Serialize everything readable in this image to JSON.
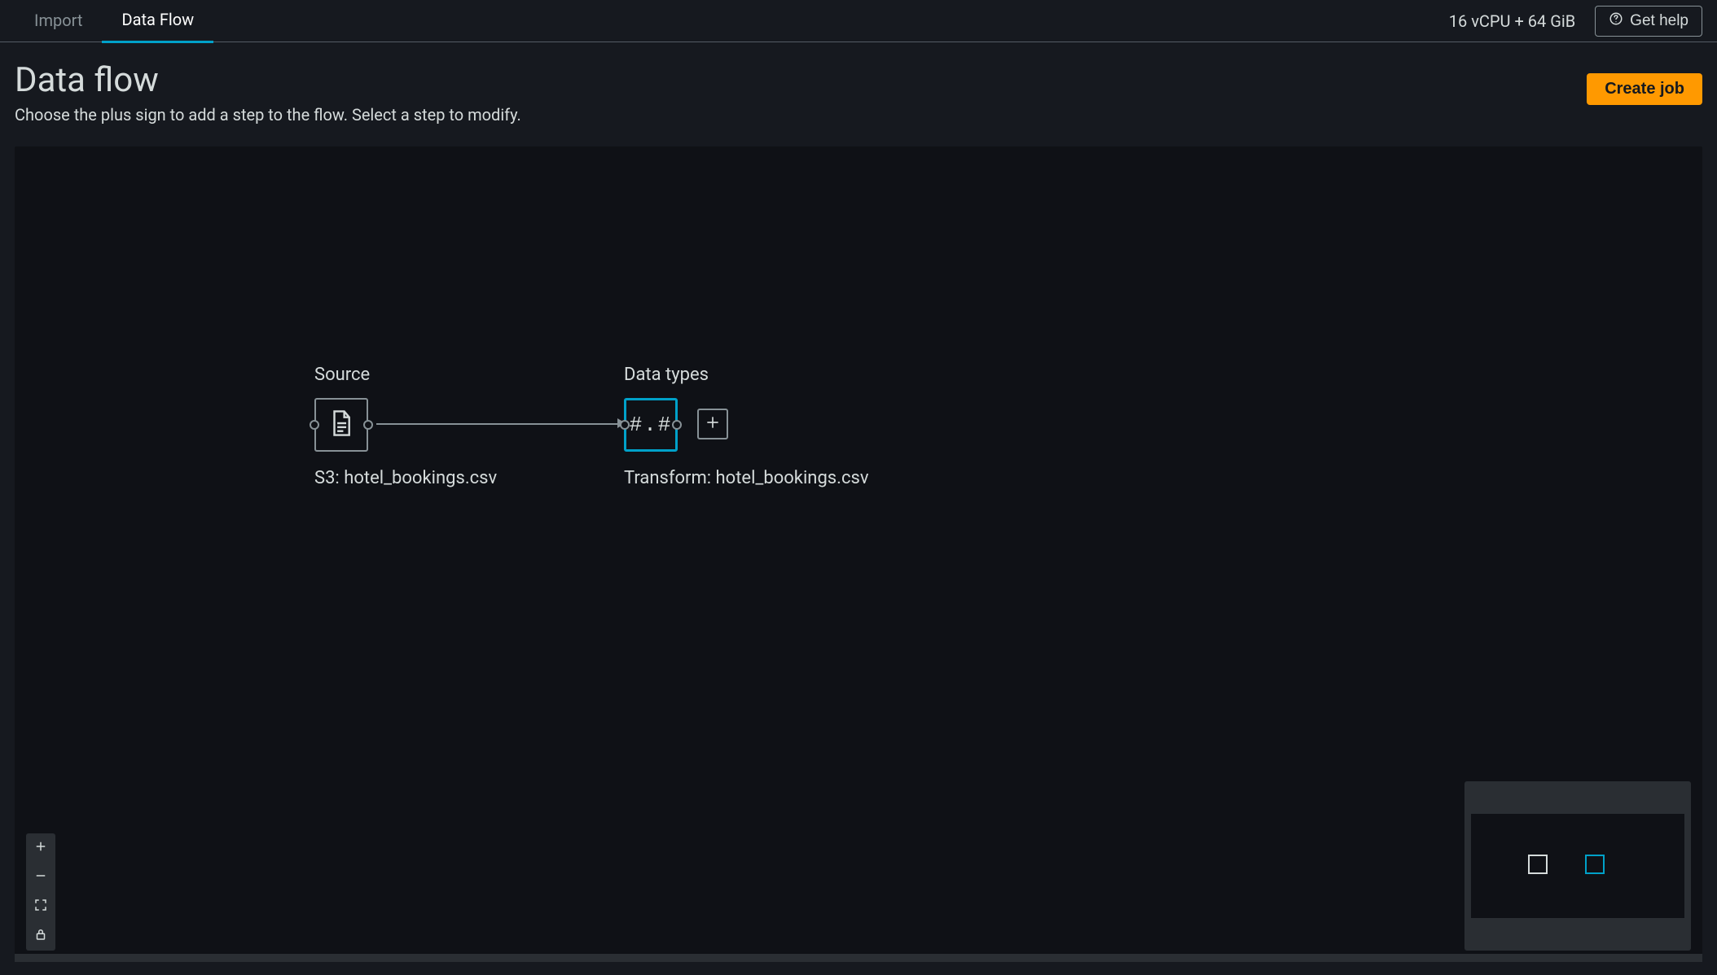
{
  "tabs": {
    "import": "Import",
    "data_flow": "Data Flow",
    "active": "data_flow"
  },
  "header_right": {
    "resources": "16 vCPU + 64 GiB",
    "get_help": "Get help"
  },
  "page": {
    "title": "Data flow",
    "subtitle": "Choose the plus sign to add a step to the flow. Select a step to modify.",
    "create_job": "Create job"
  },
  "nodes": {
    "source": {
      "top_label": "Source",
      "bottom_label": "S3: hotel_bookings.csv"
    },
    "data_types": {
      "top_label": "Data types",
      "glyph": "#.#",
      "bottom_label": "Transform: hotel_bookings.csv",
      "selected": true
    }
  },
  "icons": {
    "help": "help-circle-icon",
    "file": "file-icon",
    "plus": "plus-icon",
    "minus": "minus-icon",
    "fullscreen": "fullscreen-icon",
    "lock": "lock-icon"
  },
  "colors": {
    "accent": "#00a1c9",
    "warning": "#ff9900",
    "bg": "#16191f",
    "canvas": "#0f1116",
    "border": "#879196"
  }
}
